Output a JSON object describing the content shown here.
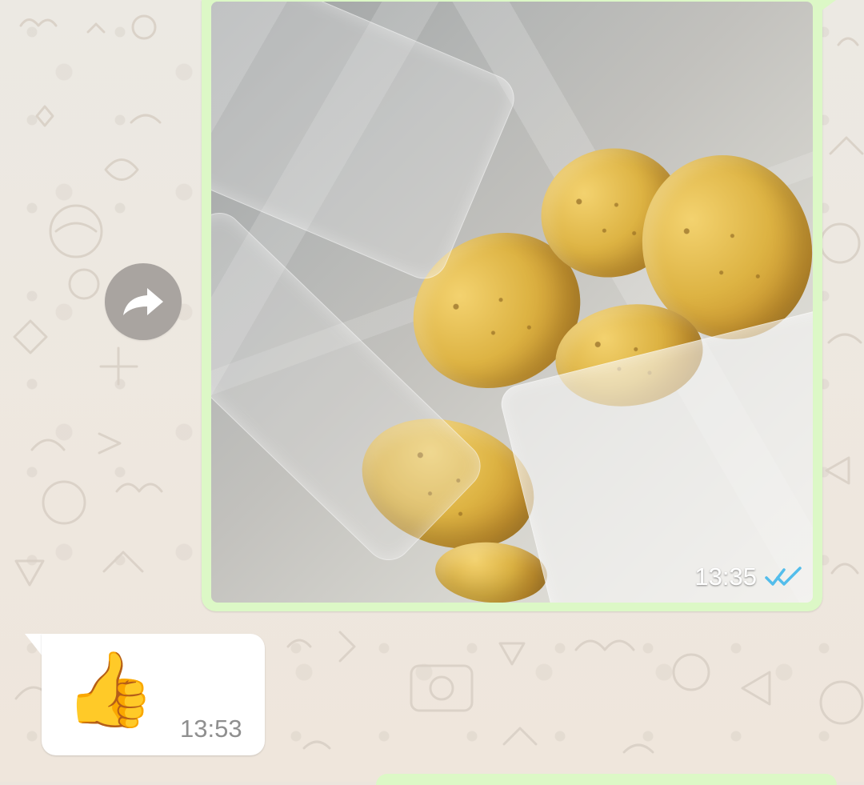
{
  "messages": {
    "outgoing_photo": {
      "time": "13:35",
      "status_icon": "double-check-icon"
    },
    "incoming_reaction": {
      "emoji": "👍",
      "time": "13:53"
    }
  },
  "controls": {
    "forward_icon": "forward-arrow-icon"
  },
  "theme": {
    "outgoing_bubble": "#dcf8c6",
    "incoming_bubble": "#ffffff",
    "wallpaper": "#ece5dd",
    "read_receipt": "#53bdeb"
  }
}
